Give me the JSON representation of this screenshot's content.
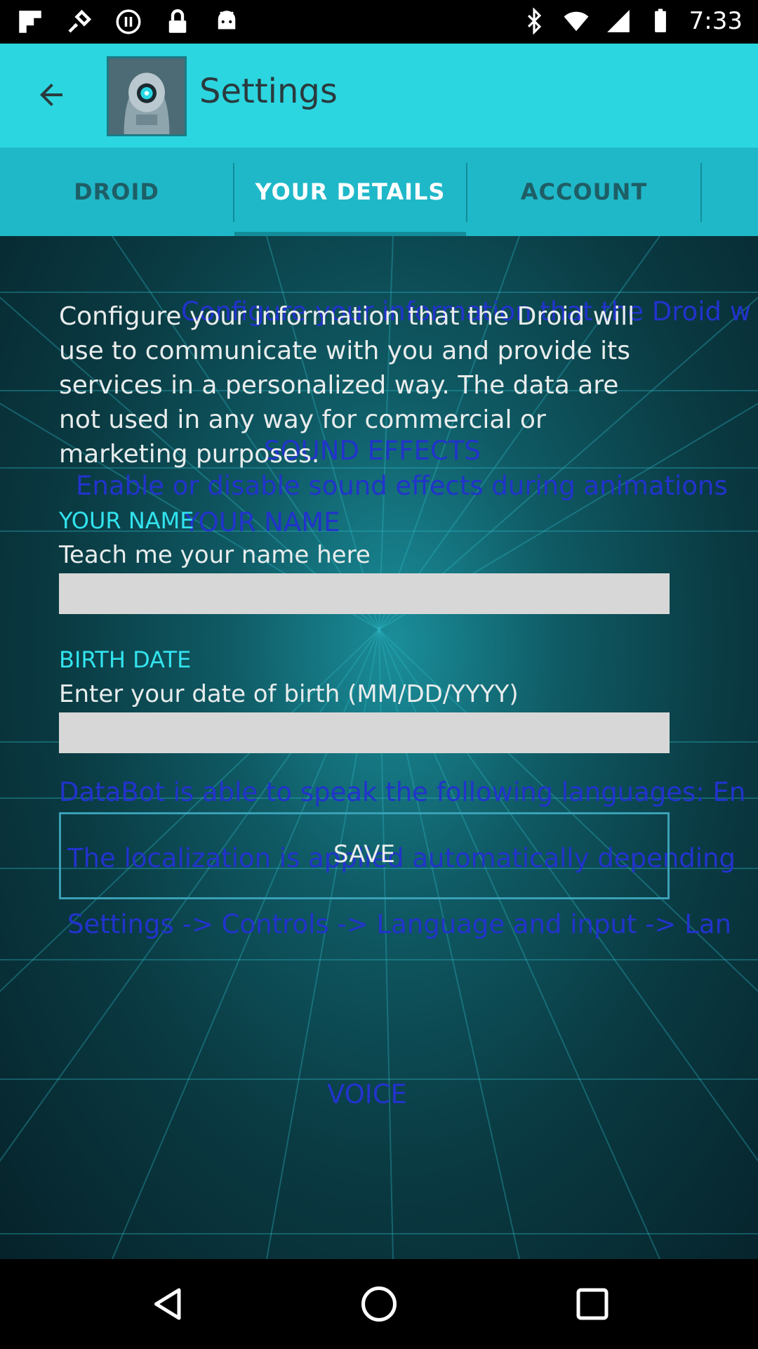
{
  "status_bar": {
    "time": "7:33",
    "left_icons": [
      "flipboard-icon",
      "fake-gps-icon",
      "pause-circle-icon",
      "lock-icon",
      "android-icon"
    ],
    "right_icons": [
      "bluetooth-icon",
      "wifi-icon",
      "signal-icon",
      "battery-icon"
    ]
  },
  "toolbar": {
    "title": "Settings",
    "back_icon": "arrow-left-icon",
    "app_icon": "robot-avatar-icon"
  },
  "tabs": [
    {
      "label": "DROID",
      "active": false
    },
    {
      "label": "YOUR DETAILS",
      "active": true
    },
    {
      "label": "ACCOUNT",
      "active": false
    }
  ],
  "content": {
    "intro": "Configure your information that the Droid will use to communicate with you and provide its services in a personalized way. The data are not used in any way for commercial or marketing purposes.",
    "name_section": {
      "label": "YOUR NAME",
      "hint": "Teach me your name here",
      "value": ""
    },
    "birth_section": {
      "label": "BIRTH DATE",
      "hint": "Enter your date of birth (MM/DD/YYYY)",
      "value": ""
    },
    "save_label": "SAVE",
    "ghost_texts": {
      "intro_overlap": "Configure your information that the Droid w",
      "sound_effects": "SOUND EFFECTS",
      "sound_effects_desc": "Enable or disable sound effects during animations",
      "your_name": "YOUR NAME",
      "languages": "DataBot is able to speak the following languages: En",
      "localization": "The localization is applied automatically depending",
      "settings_path": "Settings -> Controls -> Language and input -> Lan",
      "voice": "VOICE"
    }
  },
  "navbar": {
    "back": "back-triangle-icon",
    "home": "home-circle-icon",
    "recents": "recents-square-icon"
  },
  "colors": {
    "toolbar": "#2bd6e0",
    "tabs": "#1fb8c9",
    "accent_label": "#32e3ee",
    "ghost_text": "#2233cc"
  }
}
